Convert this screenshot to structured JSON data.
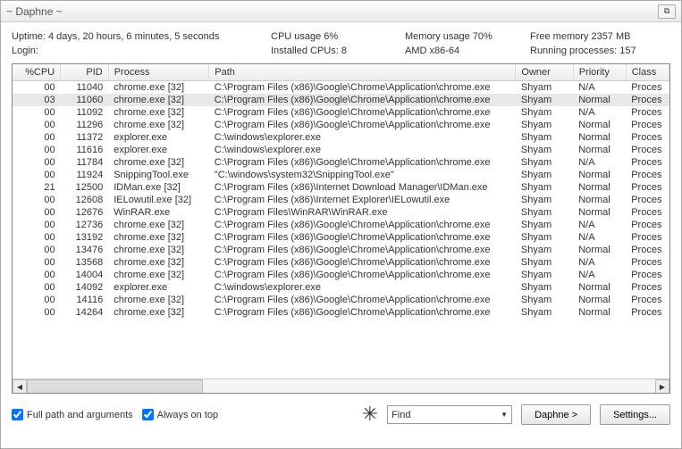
{
  "window": {
    "title": "~ Daphne ~",
    "close_glyph": "⧉"
  },
  "stats": {
    "uptime_label": "Uptime: 4 days, 20 hours,  6 minutes,  5 seconds",
    "cpu_label": "CPU usage  6%",
    "mem_label": "Memory usage  70%",
    "free_label": "Free memory 2357 MB",
    "login_label": "Login:",
    "installed_label": "Installed CPUs:  8",
    "amd_label": "AMD x86-64",
    "running_label": "Running processes:  157"
  },
  "columns": {
    "cpu": "%CPU",
    "pid": "PID",
    "process": "Process",
    "path": "Path",
    "owner": "Owner",
    "priority": "Priority",
    "class": "Class"
  },
  "rows": [
    {
      "cpu": "00",
      "pid": "11040",
      "proc": "chrome.exe [32]",
      "path": "C:\\Program Files (x86)\\Google\\Chrome\\Application\\chrome.exe",
      "owner": "Shyam",
      "prio": "N/A",
      "class": "Proces"
    },
    {
      "cpu": "03",
      "pid": "11060",
      "proc": "chrome.exe [32]",
      "path": "C:\\Program Files (x86)\\Google\\Chrome\\Application\\chrome.exe",
      "owner": "Shyam",
      "prio": "Normal",
      "class": "Proces",
      "sel": true
    },
    {
      "cpu": "00",
      "pid": "11092",
      "proc": "chrome.exe [32]",
      "path": "C:\\Program Files (x86)\\Google\\Chrome\\Application\\chrome.exe",
      "owner": "Shyam",
      "prio": "N/A",
      "class": "Proces"
    },
    {
      "cpu": "00",
      "pid": "11296",
      "proc": "chrome.exe [32]",
      "path": "C:\\Program Files (x86)\\Google\\Chrome\\Application\\chrome.exe",
      "owner": "Shyam",
      "prio": "Normal",
      "class": "Proces"
    },
    {
      "cpu": "00",
      "pid": "11372",
      "proc": "explorer.exe",
      "path": "C:\\windows\\explorer.exe",
      "owner": "Shyam",
      "prio": "Normal",
      "class": "Proces"
    },
    {
      "cpu": "00",
      "pid": "11616",
      "proc": "explorer.exe",
      "path": "C:\\windows\\explorer.exe",
      "owner": "Shyam",
      "prio": "Normal",
      "class": "Proces"
    },
    {
      "cpu": "00",
      "pid": "11784",
      "proc": "chrome.exe [32]",
      "path": "C:\\Program Files (x86)\\Google\\Chrome\\Application\\chrome.exe",
      "owner": "Shyam",
      "prio": "N/A",
      "class": "Proces"
    },
    {
      "cpu": "00",
      "pid": "11924",
      "proc": "SnippingTool.exe",
      "path": "\"C:\\windows\\system32\\SnippingTool.exe\"",
      "owner": "Shyam",
      "prio": "Normal",
      "class": "Proces"
    },
    {
      "cpu": "21",
      "pid": "12500",
      "proc": "IDMan.exe [32]",
      "path": "C:\\Program Files (x86)\\Internet Download Manager\\IDMan.exe",
      "owner": "Shyam",
      "prio": "Normal",
      "class": "Proces"
    },
    {
      "cpu": "00",
      "pid": "12608",
      "proc": "IELowutil.exe [32]",
      "path": "C:\\Program Files (x86)\\Internet Explorer\\IELowutil.exe",
      "owner": "Shyam",
      "prio": "Normal",
      "class": "Proces"
    },
    {
      "cpu": "00",
      "pid": "12676",
      "proc": "WinRAR.exe",
      "path": "C:\\Program Files\\WinRAR\\WinRAR.exe",
      "owner": "Shyam",
      "prio": "Normal",
      "class": "Proces"
    },
    {
      "cpu": "00",
      "pid": "12736",
      "proc": "chrome.exe [32]",
      "path": "C:\\Program Files (x86)\\Google\\Chrome\\Application\\chrome.exe",
      "owner": "Shyam",
      "prio": "N/A",
      "class": "Proces"
    },
    {
      "cpu": "00",
      "pid": "13192",
      "proc": "chrome.exe [32]",
      "path": "C:\\Program Files (x86)\\Google\\Chrome\\Application\\chrome.exe",
      "owner": "Shyam",
      "prio": "N/A",
      "class": "Proces"
    },
    {
      "cpu": "00",
      "pid": "13476",
      "proc": "chrome.exe [32]",
      "path": "C:\\Program Files (x86)\\Google\\Chrome\\Application\\chrome.exe",
      "owner": "Shyam",
      "prio": "Normal",
      "class": "Proces"
    },
    {
      "cpu": "00",
      "pid": "13568",
      "proc": "chrome.exe [32]",
      "path": "C:\\Program Files (x86)\\Google\\Chrome\\Application\\chrome.exe",
      "owner": "Shyam",
      "prio": "N/A",
      "class": "Proces"
    },
    {
      "cpu": "00",
      "pid": "14004",
      "proc": "chrome.exe [32]",
      "path": "C:\\Program Files (x86)\\Google\\Chrome\\Application\\chrome.exe",
      "owner": "Shyam",
      "prio": "N/A",
      "class": "Proces"
    },
    {
      "cpu": "00",
      "pid": "14092",
      "proc": "explorer.exe",
      "path": "C:\\windows\\explorer.exe",
      "owner": "Shyam",
      "prio": "Normal",
      "class": "Proces"
    },
    {
      "cpu": "00",
      "pid": "14116",
      "proc": "chrome.exe [32]",
      "path": "C:\\Program Files (x86)\\Google\\Chrome\\Application\\chrome.exe",
      "owner": "Shyam",
      "prio": "Normal",
      "class": "Proces"
    },
    {
      "cpu": "00",
      "pid": "14264",
      "proc": "chrome.exe [32]",
      "path": "C:\\Program Files (x86)\\Google\\Chrome\\Application\\chrome.exe",
      "owner": "Shyam",
      "prio": "Normal",
      "class": "Proces"
    }
  ],
  "bottom": {
    "fullpath_label": "Full path and arguments",
    "ontop_label": "Always on top",
    "star_glyph": "✳",
    "find_label": "Find",
    "daphne_btn": "Daphne >",
    "settings_btn": "Settings..."
  }
}
